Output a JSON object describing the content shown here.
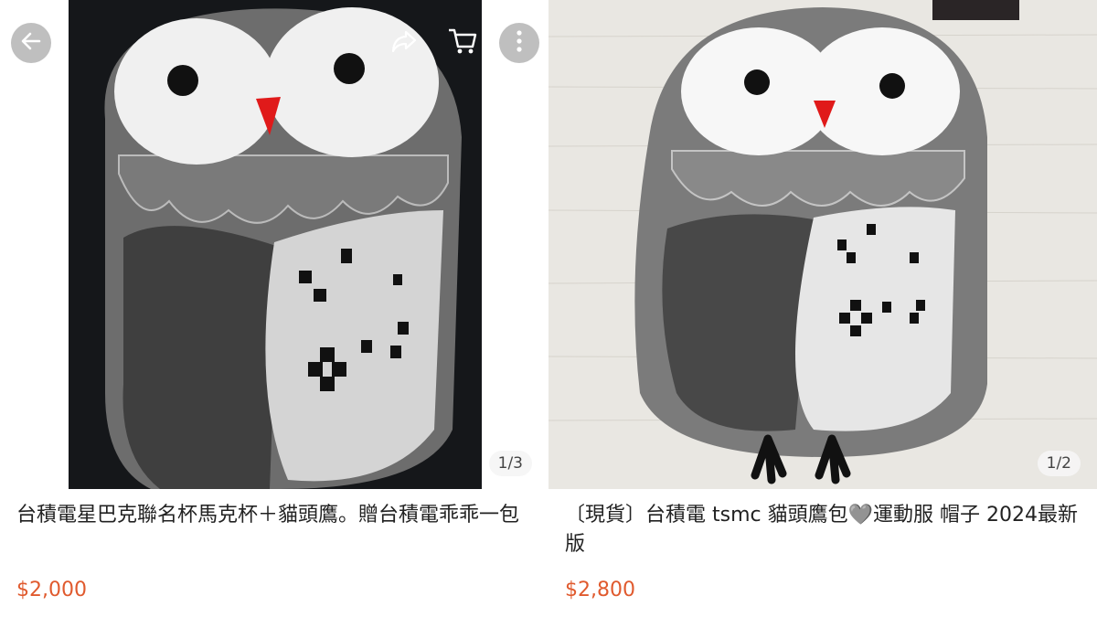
{
  "listings": [
    {
      "title": "台積電星巴克聯名杯馬克杯＋貓頭鷹。贈台積電乖乖一包",
      "price": "$2,000",
      "image_counter": "1/3"
    },
    {
      "title": "〔現貨〕台積電 tsmc 貓頭鷹包🩶運動服 帽子 2024最新版",
      "price": "$2,800",
      "image_counter": "1/2"
    }
  ],
  "toolbar": {
    "back_icon": "back-arrow-icon",
    "share_icon": "share-icon",
    "cart_icon": "cart-icon",
    "more_icon": "more-vertical-icon"
  },
  "colors": {
    "price": "#e05a2e",
    "title": "#222222"
  }
}
